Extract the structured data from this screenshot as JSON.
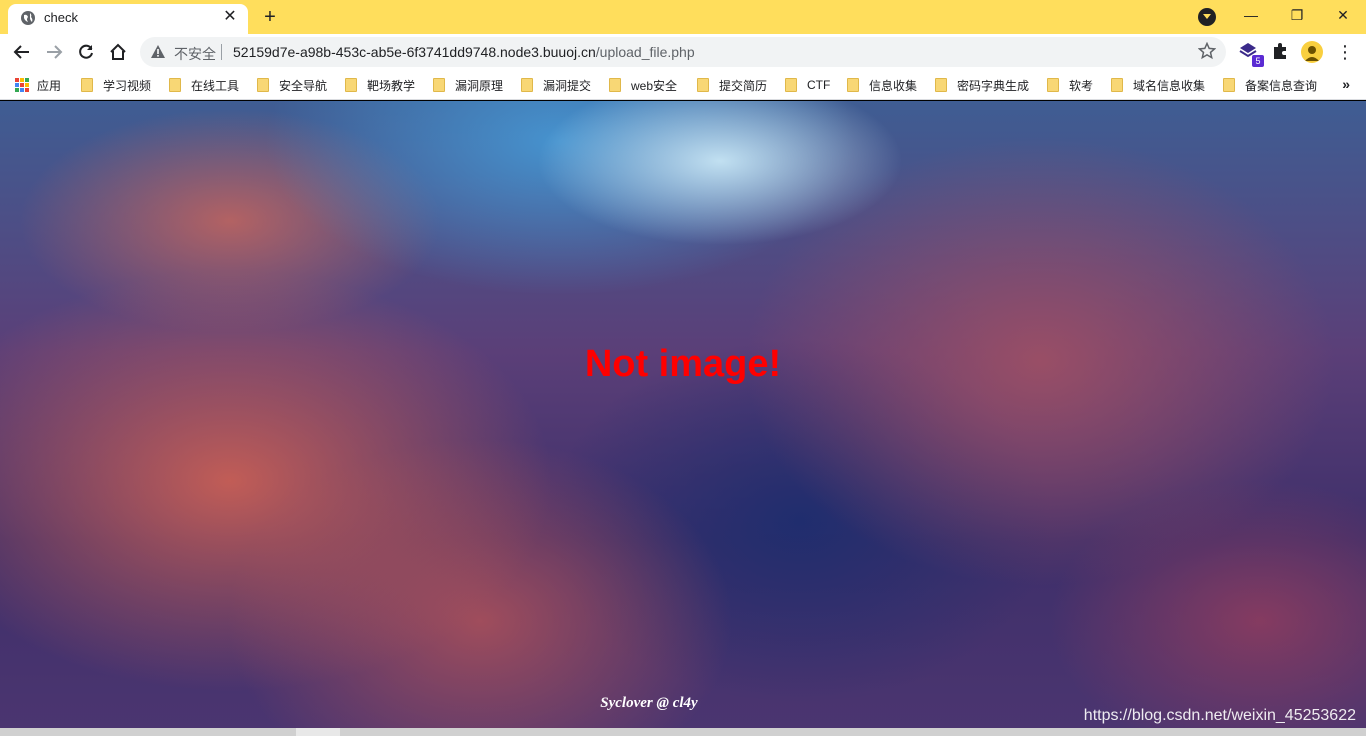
{
  "browser": {
    "tab": {
      "title": "check",
      "favicon": "globe-icon"
    },
    "new_tab_label": "+",
    "window_controls": {
      "minimize": "—",
      "restore": "❐",
      "close": "✕"
    },
    "address_bar": {
      "security_label": "不安全",
      "url_host": "52159d7e-a98b-453c-ab5e-6f3741dd9748.node3.buuoj.cn",
      "url_path": "/upload_file.php"
    },
    "extension_badge": "5"
  },
  "bookmarks": {
    "apps_label": "应用",
    "items": [
      "学习视频",
      "在线工具",
      "安全导航",
      "靶场教学",
      "漏洞原理",
      "漏洞提交",
      "web安全",
      "提交简历",
      "CTF",
      "信息收集",
      "密码字典生成",
      "软考",
      "域名信息收集",
      "备案信息查询"
    ],
    "more_label": "»"
  },
  "page": {
    "message": "Not image!",
    "credit": "Syclover @ cl4y",
    "watermark": "https://blog.csdn.net/weixin_45253622"
  },
  "colors": {
    "tabstrip": "#ffde5c",
    "message": "#ff0000"
  }
}
